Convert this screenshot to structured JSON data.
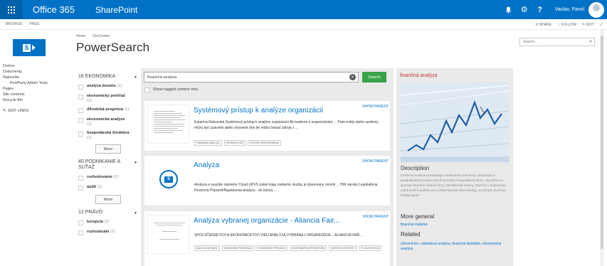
{
  "suitebar": {
    "app_name": "Office 365",
    "site_name": "SharePoint",
    "user_name": "Vaclav, Pavol",
    "bell_glyph": "🔔",
    "gear_glyph": "⚙",
    "help_glyph": "?"
  },
  "ribbon": {
    "tabs": [
      "BROWSE",
      "PAGE"
    ],
    "share": "SHARE",
    "follow": "FOLLOW",
    "edit": "EDIT"
  },
  "header": {
    "breadcrumb": [
      "Home",
      "DocCenter"
    ],
    "title": "PowerSearch",
    "search_placeholder": "Search..."
  },
  "leftnav": {
    "items": [
      "Domov",
      "Dokumenty",
      "Najnovšie",
      "PoolParty Admin Tools",
      "Pages",
      "Site contents",
      "Recycle Bin"
    ],
    "edit_links": "EDIT LINKS"
  },
  "refiners": {
    "groups": [
      {
        "title": "16 EKONOMIKA",
        "items": [
          {
            "label": "analýza dosahu",
            "count": "(2)"
          },
          {
            "label": "ekonomický prehľad",
            "count": "(2)"
          },
          {
            "label": "dlhodobá prognóza",
            "count": "(1)"
          },
          {
            "label": "ekonomická analýza",
            "count": "(1)"
          },
          {
            "label": "hospodárska štruktúra",
            "count": "(1)"
          }
        ],
        "more": "More"
      },
      {
        "title": "40 PODNIKANIE A SÚŤAŽ",
        "items": [
          {
            "label": "rozhodovanie",
            "count": "(2)"
          },
          {
            "label": "audit",
            "count": "(1)"
          }
        ],
        "more": "More"
      },
      {
        "title": "12 PRÁVO",
        "items": [
          {
            "label": "korupcia",
            "count": "(2)"
          },
          {
            "label": "rozhodnutie",
            "count": "(2)"
          }
        ]
      }
    ]
  },
  "search": {
    "query": "finančná analýza",
    "button": "Search",
    "tagged_label": "Show tagged content only"
  },
  "results": [
    {
      "title": "Systémový prístup k analýze organizácií",
      "show_parent": "SHOW PARENT",
      "snippet": "Katarína Rakovská Systémový prístup k analýze organizácií Ak budeme k organizáciám ... Tieto entity alebo systémy môžu byť uzavreté alebo otvorené (len tie môžu čerpať zdroje z ...",
      "tags": [
        "FINANČNÁ ANALÝZA",
        "PRODUKTIVITA",
        "SYSTÉM HOSPODÁRENIA"
      ]
    },
    {
      "title": "Analyza",
      "show_parent": "SHOW PARENT",
      "snippet": "Analyza a vyuzitie statneho Cloud UPVS zatial maju zadarmo sluzby, je planovany cennik ... HW naroky Legislativna Financna Pripravit/Naplanovat analyzu - do konca ...",
      "tags": []
    },
    {
      "title": "Analýza vybranej organizácie - Aliancia Fair...",
      "show_parent": "SHOW PARENT",
      "snippet": "SPOLOČENSKÝCH A EKONOMICKÝCH VIED ANALÝZA VYBRANEJ ORGANIZÁCIE – ALIANCIA FAIR ...",
      "tags": [
        "ANALÝZA DOSAHU",
        "DLHODOBÁ PROGNÓZA",
        "EKONOMICKÝ PREHĽAD",
        "HOSPODÁRSKA ŠTRUKTÚRA",
        "KAPITÁLOVÉ STATKY",
        "PLÁN ROZVOJA"
      ]
    }
  ],
  "preview": {
    "title": "finančná analýza",
    "description_heading": "Description",
    "description": "Finančná analýza predstavuje ohodnotenie minulosti, súčasnosti a predpokladanej budúcnosti finančného hospodárenia firmy. Jej cieľom je spoznať finančné zdravie firmy, identifikovať slabiny, ktoré by v budúcnosti mohli viesť k problémom a determinovať silné stránky, na ktorých by firma mohla stavať.",
    "more_general_heading": "More general",
    "more_general": "finančné riadenie",
    "related_heading": "Related",
    "related": "účtovníctvo, nákladová analýza, finančná štatistika, ekonomická analýza"
  },
  "colors": {
    "suitebar": "#0072c6",
    "link": "#0072c6",
    "search_button": "#3aa34a",
    "preview_title": "#c0392b"
  }
}
